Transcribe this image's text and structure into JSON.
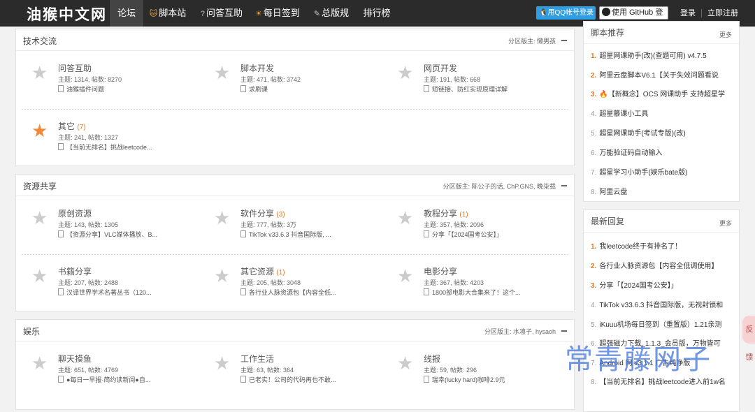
{
  "nav": {
    "logo": "油猴中文网",
    "items": [
      {
        "label": "论坛",
        "icon": ""
      },
      {
        "label": "脚本站",
        "icon": "cat-icon"
      },
      {
        "label": "问答互助",
        "icon": "question-icon"
      },
      {
        "label": "每日签到",
        "icon": "sun-icon"
      },
      {
        "label": "总版规",
        "icon": "pencil-icon"
      },
      {
        "label": "排行榜",
        "icon": ""
      }
    ],
    "qq_login": "用QQ帐号登录",
    "github_login": "使用 GitHub 登录",
    "login": "登录",
    "register": "立即注册"
  },
  "sections": [
    {
      "title": "技术交流",
      "moderators": "分区版主: 懒男孩",
      "forums": [
        {
          "name": "问答互助",
          "new": "",
          "stats": "主题: 1314, 帖数: 8270",
          "last": "油猴插件问题",
          "hot": false
        },
        {
          "name": "脚本开发",
          "new": "",
          "stats": "主题: 471, 帖数: 3742",
          "last": "求刷课",
          "hot": false
        },
        {
          "name": "网页开发",
          "new": "",
          "stats": "主题: 191, 帖数: 668",
          "last": "短链接、防红实现原理详解",
          "hot": false
        },
        {
          "name": "其它",
          "new": "(7)",
          "stats": "主题: 241, 帖数: 1327",
          "last": "【当前无排名】挑战leetcode...",
          "hot": true
        }
      ]
    },
    {
      "title": "资源共享",
      "moderators": "分区版主: 陈公子的话, ChP.GNS, 晚柒载",
      "forums": [
        {
          "name": "原创资源",
          "new": "",
          "stats": "主题: 143, 帖数: 1305",
          "last": "【资源分享】VLC媒体播放、B...",
          "hot": false
        },
        {
          "name": "软件分享",
          "new": "(3)",
          "stats": "主题: 777, 帖数: 3万",
          "last": "TikTok v33.6.3 抖音国际版, ...",
          "hot": false
        },
        {
          "name": "教程分享",
          "new": "(1)",
          "stats": "主题: 357, 帖数: 2096",
          "last": "分享「【2024国考公安】」",
          "hot": false
        },
        {
          "name": "书籍分享",
          "new": "",
          "stats": "主题: 207, 帖数: 2488",
          "last": "汉译世界学术名著丛书（120...",
          "hot": false
        },
        {
          "name": "其它资源",
          "new": "(1)",
          "stats": "主题: 205, 帖数: 3048",
          "last": "各行业人脉资源包【内容全低...",
          "hot": false
        },
        {
          "name": "电影分享",
          "new": "",
          "stats": "主题: 367, 帖数: 4203",
          "last": "1800部电影大合集来了！这个...",
          "hot": false
        }
      ]
    },
    {
      "title": "娱乐",
      "moderators": "分区版主: 水凛子, hysaoh",
      "forums": [
        {
          "name": "聊天摸鱼",
          "new": "",
          "stats": "主题: 651, 帖数: 4769",
          "last": "●每日一早报·简约读新闻●自...",
          "hot": false
        },
        {
          "name": "工作生活",
          "new": "",
          "stats": "主题: 63, 帖数: 364",
          "last": "已老实！公司的代码再也不敢...",
          "hot": false
        },
        {
          "name": "线报",
          "new": "",
          "stats": "主题: 59, 帖数: 296",
          "last": "瑞幸(lucky hard)咖啡2.9元",
          "hot": false
        }
      ]
    }
  ],
  "scripts_panel": {
    "title": "脚本推荐",
    "more": "更多",
    "items": [
      {
        "num": "1.",
        "text": "超星网课助手(改)(查题可用) v4.7.5"
      },
      {
        "num": "2.",
        "text": "阿里云盘脚本V6.1【关于失效问题看说"
      },
      {
        "num": "3.",
        "text": "🔥【新概念】OCS 网课助手 支持超星学"
      },
      {
        "num": "4.",
        "text": "超星慕课小工具"
      },
      {
        "num": "5.",
        "text": "超星网课助手(考试专版)(改)"
      },
      {
        "num": "6.",
        "text": "万能验证码自动输入"
      },
      {
        "num": "7.",
        "text": "超星学习小助手(娱乐bate版)"
      },
      {
        "num": "8.",
        "text": "阿里云盘"
      }
    ]
  },
  "replies_panel": {
    "title": "最新回复",
    "more": "更多",
    "items": [
      {
        "num": "1.",
        "text": "我leetcode终于有排名了！"
      },
      {
        "num": "2.",
        "text": "各行业人脉资源包【内容全低调使用】"
      },
      {
        "num": "3.",
        "text": "分享「【2024国考公安】」"
      },
      {
        "num": "4.",
        "text": "TikTok v33.6.3 抖音国际版，无视封锁和"
      },
      {
        "num": "5.",
        "text": "iKuuu机场每日签到（重置版）1.21亲测"
      },
      {
        "num": "6.",
        "text": "超强磁力下载_1.1.3_会员版，万物皆可"
      },
      {
        "num": "7.",
        "text": "Android 网 v3.1.1 广告纯净版"
      },
      {
        "num": "8.",
        "text": "【当前无排名】挑战leetcode进入前1w名"
      }
    ]
  },
  "watermark": "常青藤网子",
  "side_tab": "反馈"
}
